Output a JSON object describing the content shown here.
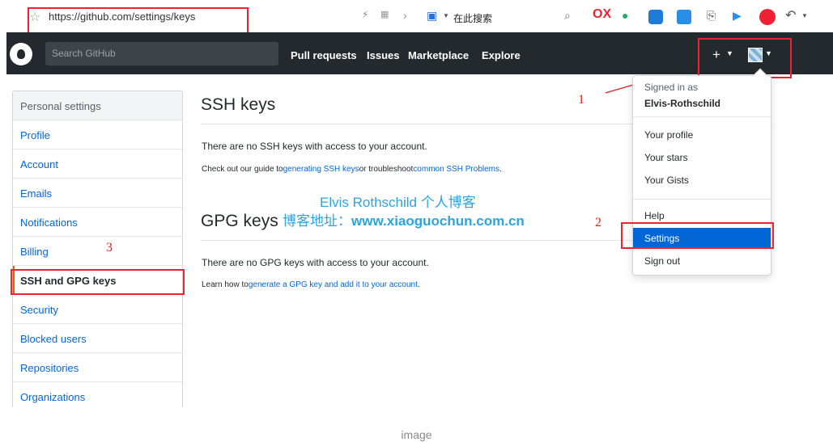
{
  "browser": {
    "url": "https://github.com/settings/keys",
    "search_label": "在此搜索",
    "icon_colors": {
      "ox": "#e23",
      "wechat": "#2aae67",
      "note": "#1f7bd8",
      "translate": "#2a8ee6",
      "play": "#2a8ee6",
      "abp": "#e23"
    }
  },
  "header": {
    "search_placeholder": "Search GitHub",
    "nav": [
      "Pull requests",
      "Issues",
      "Marketplace",
      "Explore"
    ],
    "new_label": "+",
    "background": "#24292e"
  },
  "sidebar": {
    "heading": "Personal settings",
    "items": [
      {
        "label": "Profile"
      },
      {
        "label": "Account"
      },
      {
        "label": "Emails"
      },
      {
        "label": "Notifications"
      },
      {
        "label": "Billing"
      },
      {
        "label": "SSH and GPG keys"
      },
      {
        "label": "Security"
      },
      {
        "label": "Blocked users"
      },
      {
        "label": "Repositories"
      },
      {
        "label": "Organizations"
      }
    ],
    "selected_index": 5
  },
  "main": {
    "ssh_title": "SSH keys",
    "ssh_empty": "There are no SSH keys with access to your account.",
    "ssh_help_prefix": "Check out our guide to",
    "ssh_help_link1": "generating SSH keys",
    "ssh_help_middle": "or troubleshoot",
    "ssh_help_link2": "common SSH Problems",
    "ssh_help_suffix": ".",
    "gpg_title": "GPG keys",
    "gpg_empty": "There are no GPG keys with access to your account.",
    "gpg_help_prefix": "Learn how to",
    "gpg_help_link": "generate a GPG key and add it to your account",
    "gpg_help_suffix": "."
  },
  "watermark": {
    "line1": "Elvis  Rothschild   个人博客",
    "line2_prefix": "博客地址：",
    "line2_url": "www.xiaoguochun.com.cn"
  },
  "dropdown": {
    "signed_in_label": "Signed in as",
    "username": "Elvis-Rothschild",
    "group1": [
      "Your profile",
      "Your stars",
      "Your Gists"
    ],
    "help": "Help",
    "settings": "Settings",
    "sign_out": "Sign out"
  },
  "annotations": {
    "one": "1",
    "two": "2",
    "three": "3"
  },
  "caption": "image",
  "colors": {
    "annotation": "#dd2222",
    "link": "#0366d6",
    "accent": "#e36209"
  }
}
